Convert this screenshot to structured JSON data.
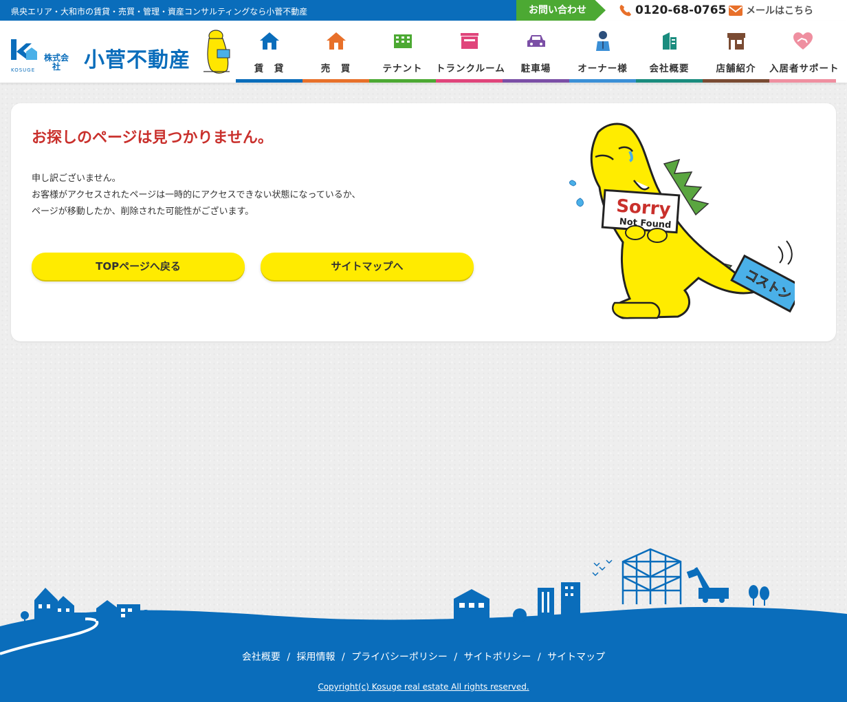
{
  "topbar": {
    "tagline": "県央エリア・大和市の賃貸・売買・管理・資産コンサルティングなら小菅不動産",
    "contact_label": "お問い合わせ",
    "phone": "0120-68-0765",
    "mail": "メールはこちら"
  },
  "logo": {
    "company": "小菅不動産",
    "type": "株式会社",
    "romaji": "KOSUGE"
  },
  "nav": {
    "items": [
      {
        "label": "賃　貸",
        "icon": "house-icon",
        "color": "#0a6dbb"
      },
      {
        "label": "売　買",
        "icon": "house-icon",
        "color": "#e8702a"
      },
      {
        "label": "テナント",
        "icon": "building-icon",
        "color": "#4ca933"
      },
      {
        "label": "トランクルーム",
        "icon": "storage-icon",
        "color": "#e0457b"
      },
      {
        "label": "駐車場",
        "icon": "car-icon",
        "color": "#7b4fa6"
      },
      {
        "label": "オーナー様",
        "icon": "owner-icon",
        "color": "#3a8fd6"
      },
      {
        "label": "会社概要",
        "icon": "office-icon",
        "color": "#1a8c7e"
      },
      {
        "label": "店舗紹介",
        "icon": "shop-icon",
        "color": "#7a4b33"
      },
      {
        "label": "入居者サポート",
        "icon": "heart-hand-icon",
        "color": "#ef8fa0"
      }
    ]
  },
  "error": {
    "title": "お探しのページは見つかりません。",
    "lines": [
      "申し訳ございません。",
      "お客様がアクセスされたページは一時的にアクセスできない状態になっているか、",
      "ページが移動したか、削除された可能性がございます。"
    ],
    "btn_top": "TOPページへ戻る",
    "btn_sitemap": "サイトマップへ"
  },
  "mascot": {
    "sign_big": "Sorry",
    "sign_small": "Not Found",
    "box_text": "コストン"
  },
  "footer": {
    "links": [
      "会社概要",
      "採用情報",
      "プライバシーポリシー",
      "サイトポリシー",
      "サイトマップ"
    ],
    "separator": "/",
    "copyright": "Copyright(c) Kosuge real estate All rights reserved."
  },
  "colors": {
    "brand_blue": "#0a6dbb",
    "contact_green": "#4ca933",
    "error_red": "#c9302c",
    "button_yellow": "#ffeb00"
  }
}
